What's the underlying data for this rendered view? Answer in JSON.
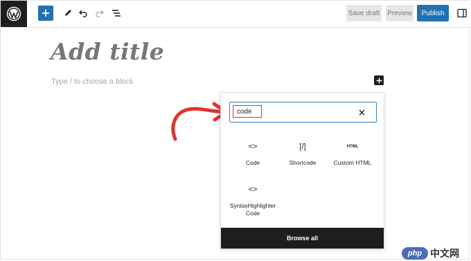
{
  "toolbar": {
    "save_draft_label": "Save draft",
    "preview_label": "Preview",
    "publish_label": "Publish",
    "add_icon": "plus-icon",
    "accent_color": "#2271b1"
  },
  "editor": {
    "title_placeholder": "Add title",
    "block_placeholder": "Type / to choose a block"
  },
  "inserter": {
    "search_value": "code",
    "results": [
      {
        "label": "Code",
        "icon": "<>"
      },
      {
        "label": "Shortcode",
        "icon": "[/]"
      },
      {
        "label": "Custom HTML",
        "icon": "HTML"
      },
      {
        "label": "SyntaxHighlighter Code",
        "icon": "<>"
      }
    ],
    "browse_all_label": "Browse all"
  },
  "watermark": {
    "badge": "php",
    "text": "中文网"
  },
  "colors": {
    "highlight_red": "#e0332f",
    "search_border": "#3582c4",
    "dark": "#1e1e1e"
  }
}
